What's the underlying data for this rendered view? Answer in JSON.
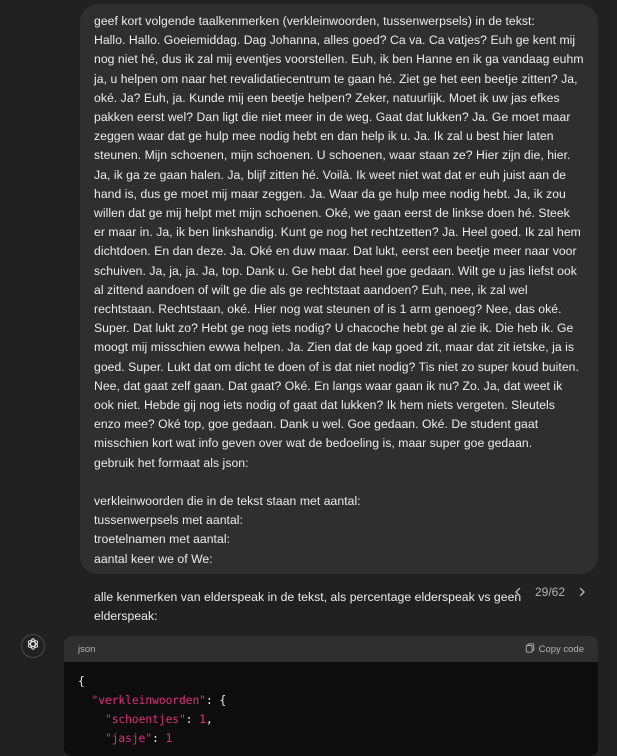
{
  "user_message": {
    "lines": [
      "geef kort volgende taalkenmerken (verkleinwoorden, tussenwerpsels) in de tekst:",
      "Hallo. Hallo. Goeiemiddag. Dag Johanna, alles goed? Ca va. Ca vatjes? Euh ge kent mij nog niet hé, dus ik zal mij eventjes voorstellen. Euh, ik ben Hanne en ik ga vandaag euhm ja, u helpen om naar het revalidatiecentrum te gaan hé. Ziet ge het een beetje zitten? Ja, oké. Ja? Euh, ja. Kunde mij een beetje helpen? Zeker, natuurlijk. Moet ik uw jas efkes pakken eerst wel? Dan ligt die niet meer in de weg. Gaat dat lukken? Ja. Ge moet maar zeggen waar dat ge hulp mee nodig hebt en dan help ik u. Ja. Ik zal u best hier laten steunen. Mijn schoenen, mijn schoenen. U schoenen, waar staan ze? Hier zijn die, hier. Ja, ik ga ze gaan halen. Ja, blijf zitten hé. Voilà. Ik weet niet wat dat er euh juist aan de hand is, dus ge moet mij maar zeggen. Ja. Waar da ge hulp mee nodig hebt. Ja, ik zou willen dat ge mij helpt met mijn schoenen. Oké, we gaan eerst de linkse doen hé. Steek er maar in. Ja, ik ben linkshandig. Kunt ge nog het rechtzetten? Ja. Heel goed. Ik zal hem dichtdoen. En dan deze. Ja. Oké en duw maar. Dat lukt, eerst een beetje meer naar voor schuiven. Ja, ja, ja. Ja, top. Dank u. Ge hebt dat heel goe gedaan. Wilt ge u jas liefst ook al zittend aandoen of wilt ge die als ge rechtstaat aandoen? Euh, nee, ik zal wel rechtstaan. Rechtstaan, oké. Hier nog wat steunen of is 1 arm genoeg? Nee, das oké.  Super. Dat lukt zo? Hebt ge nog iets nodig? U chacoche hebt ge al zie ik. Die heb ik. Ge moogt mij misschien ewwa helpen. Ja. Zien dat de kap goed zit, maar dat zit ietske, ja is goed. Super. Lukt dat om dicht te doen of is dat niet nodig? Tis niet zo super koud buiten. Nee, dat gaat zelf gaan. Dat gaat? Oké. En langs waar gaan ik nu? Zo. Ja, dat weet ik ook niet. Hebde gij nog iets nodig of gaat dat lukken? Ik hem niets vergeten. Sleutels enzo mee? Oké top, goe gedaan. Dank u wel. Goe gedaan. Oké. De student gaat misschien kort wat info geven over wat de bedoeling is, maar super goe gedaan.",
      "gebruik het formaat als json:",
      "",
      "verkleinwoorden die in de tekst staan met aantal:",
      "tussenwerpsels met aantal:",
      "troetelnamen met aantal:",
      "aantal keer we of We:",
      "",
      "alle kenmerken van elderspeak in de tekst, als percentage elderspeak vs geen elderspeak:"
    ]
  },
  "pager": {
    "prev_icon": "chevron-left-icon",
    "next_icon": "chevron-right-icon",
    "label": "29/62"
  },
  "assistant": {
    "avatar_icon": "openai-logo-icon",
    "code_block": {
      "language": "json",
      "copy_label": "Copy code",
      "lines": [
        [
          {
            "t": "{",
            "c": "punc"
          }
        ],
        [
          {
            "t": "  ",
            "c": "punc"
          },
          {
            "t": "\"verkleinwoorden\"",
            "c": "key"
          },
          {
            "t": ": {",
            "c": "punc"
          }
        ],
        [
          {
            "t": "    ",
            "c": "punc"
          },
          {
            "t": "\"schoentjes\"",
            "c": "key"
          },
          {
            "t": ": ",
            "c": "punc"
          },
          {
            "t": "1",
            "c": "num"
          },
          {
            "t": ",",
            "c": "punc"
          }
        ],
        [
          {
            "t": "    ",
            "c": "punc"
          },
          {
            "t": "\"jasje\"",
            "c": "key"
          },
          {
            "t": ": ",
            "c": "punc"
          },
          {
            "t": "1",
            "c": "num"
          }
        ]
      ]
    }
  },
  "colors": {
    "background": "#212121",
    "bubble": "#2f2f2f",
    "code_bg": "#0d0d0d",
    "json_key": "#df3079"
  }
}
